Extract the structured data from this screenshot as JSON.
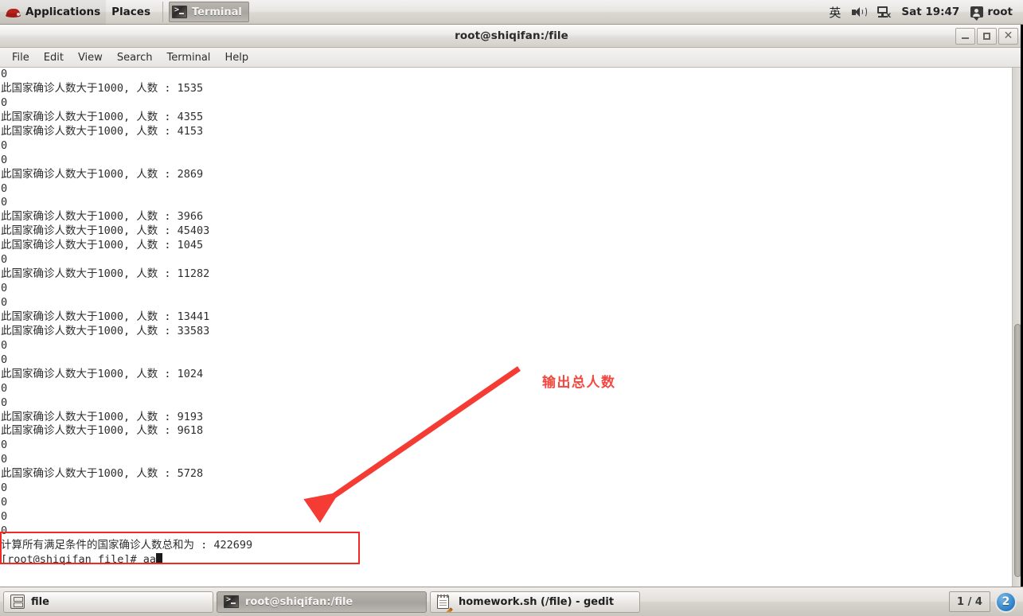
{
  "top_panel": {
    "applications_label": "Applications",
    "places_label": "Places",
    "window_list_item": "Terminal",
    "tray": {
      "ime_label": "英",
      "volume_icon": "speaker-icon",
      "network_icon": "network-disconnected-icon",
      "clock": "Sat 19:47",
      "user_icon": "user-icon",
      "user_label": "root"
    }
  },
  "window": {
    "title": "root@shiqifan:/file",
    "minimize_label": "Minimize",
    "maximize_label": "Maximize",
    "close_label": "Close",
    "menus": [
      {
        "label": "File"
      },
      {
        "label": "Edit"
      },
      {
        "label": "View"
      },
      {
        "label": "Search"
      },
      {
        "label": "Terminal"
      },
      {
        "label": "Help"
      }
    ]
  },
  "terminal": {
    "lines": [
      "0",
      "此国家确诊人数大于1000, 人数 : 1535",
      "0",
      "此国家确诊人数大于1000, 人数 : 4355",
      "此国家确诊人数大于1000, 人数 : 4153",
      "0",
      "0",
      "此国家确诊人数大于1000, 人数 : 2869",
      "0",
      "0",
      "此国家确诊人数大于1000, 人数 : 3966",
      "此国家确诊人数大于1000, 人数 : 45403",
      "此国家确诊人数大于1000, 人数 : 1045",
      "0",
      "此国家确诊人数大于1000, 人数 : 11282",
      "0",
      "0",
      "此国家确诊人数大于1000, 人数 : 13441",
      "此国家确诊人数大于1000, 人数 : 33583",
      "0",
      "0",
      "此国家确诊人数大于1000, 人数 : 1024",
      "0",
      "0",
      "此国家确诊人数大于1000, 人数 : 9193",
      "此国家确诊人数大于1000, 人数 : 9618",
      "0",
      "0",
      "此国家确诊人数大于1000, 人数 : 5728",
      "0",
      "0",
      "0",
      "0",
      "计算所有满足条件的国家确诊人数总和为 : 422699"
    ],
    "prompt": "[root@shiqifan file]# ",
    "typed_command": "aa",
    "total_sum": "422699",
    "threshold": "1000"
  },
  "annotation": {
    "text": "输出总人数",
    "color": "#f4473f",
    "box_color": "#ef2b24"
  },
  "bottom_panel": {
    "tasks": [
      {
        "label": "file",
        "icon": "file-manager-icon",
        "active": false
      },
      {
        "label": "root@shiqifan:/file",
        "icon": "terminal-icon",
        "active": true
      },
      {
        "label": "homework.sh (/file) - gedit",
        "icon": "gedit-icon",
        "active": false
      }
    ],
    "workspace_indicator": "1 / 4",
    "notification_badge": "2"
  }
}
